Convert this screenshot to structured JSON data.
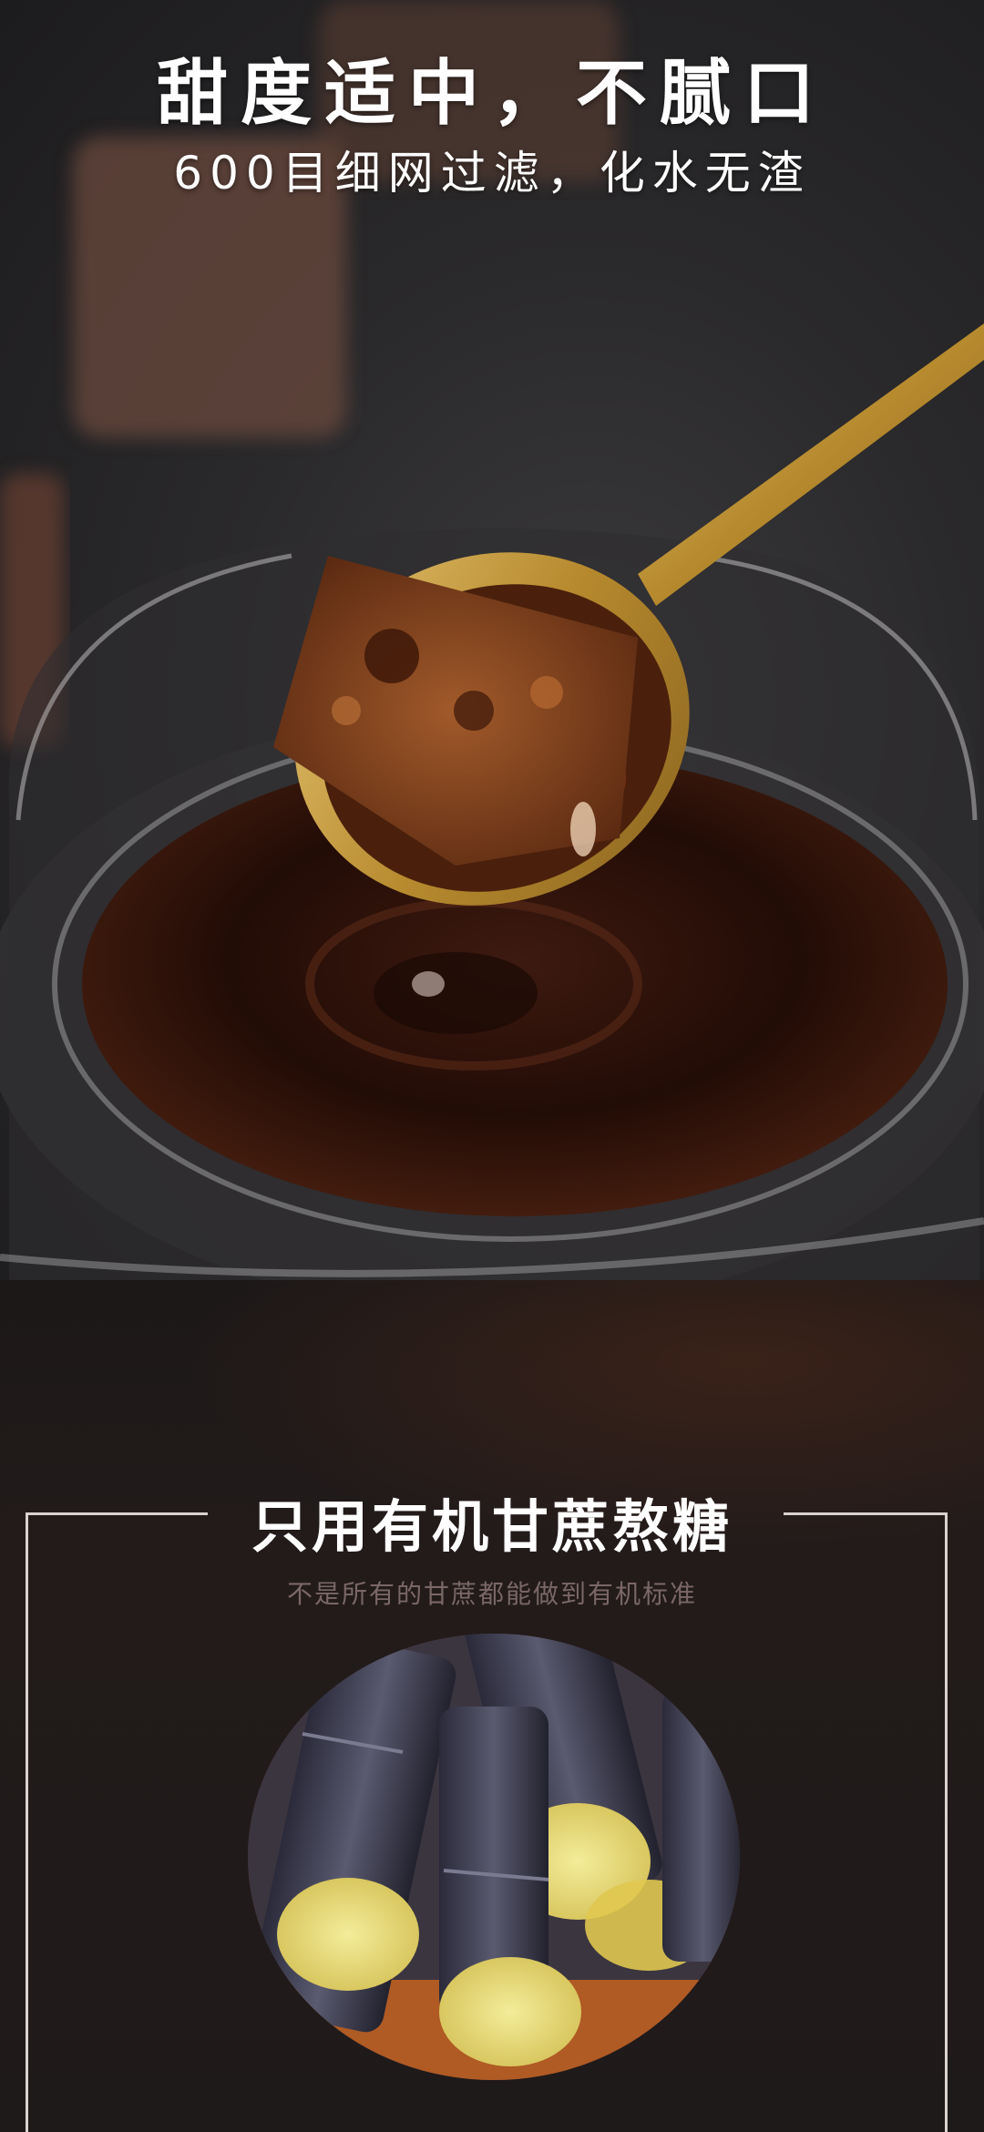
{
  "hero": {
    "title": "甜度适中，不腻口",
    "subtitle": "600目细网过滤，化水无渣",
    "photo_icon": "spoon-brown-sugar-glass-photo"
  },
  "section": {
    "title": "只用有机甘蔗熬糖",
    "subtitle": "不是所有的甘蔗都能做到有机标准",
    "photo_icon": "sugarcane-photo"
  },
  "colors": {
    "background": "#1d1818",
    "title_text": "#ffffff",
    "subtitle_text": "#7a6766",
    "frame_line": "#d9d2cf",
    "spoon_gold": "#c49a3a",
    "syrup": "#2a0f08"
  }
}
